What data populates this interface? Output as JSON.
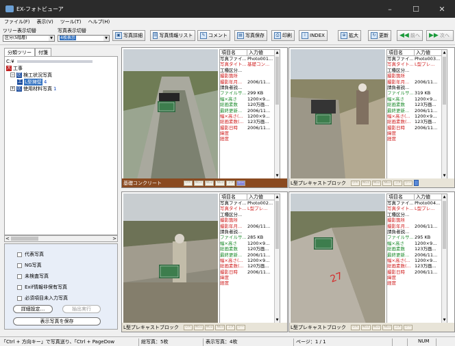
{
  "window": {
    "title": "EX-フォトビューア",
    "min": "–",
    "max": "☐",
    "close": "✕"
  },
  "menu": [
    "ファイル(F)",
    "表示(V)",
    "ツール(T)",
    "ヘルプ(H)"
  ],
  "toolbar": {
    "tree_switch_label": "ツリー表示切替",
    "photo_switch_label": "写真表示切替",
    "tree_mode": "区分(5階層)",
    "photo_mode": "4枚表示",
    "buttons": [
      "写真詳細",
      "写真情報リスト",
      "コメント",
      "写真保存",
      "印刷",
      "INDEX",
      "拡大",
      "更新",
      "前へ",
      "次へ"
    ]
  },
  "left": {
    "tabs": [
      "分類ツリー",
      "付箋"
    ],
    "path": "C:¥",
    "tree": {
      "root": "工事",
      "node1": "検工状況写真",
      "node2": "L型擁壁",
      "node2_count": "4",
      "node3": "使用材料写真",
      "node3_count": "1"
    },
    "filters": [
      "代表写真",
      "NG写真",
      "未検査写真",
      "Exif情報非保有写真",
      "必須項目未入力写真"
    ],
    "detail_button": "詳細設定...",
    "extract_button": "抽出実行",
    "save_button": "表示写真を保存"
  },
  "props_header": [
    "項目名",
    "入力値"
  ],
  "prop_names": [
    "写真ファイ...",
    "写真タイト...",
    "工種区分...",
    "撮影箇所",
    "撮影年月...",
    "請負者説...",
    "ファイルサ...",
    "幅×高さ",
    "総画素数",
    "最終更新...",
    "幅×高さ(...",
    "総画素数(...",
    "撮影日時",
    "緯度",
    "経度"
  ],
  "badges": [
    "ＯＫ",
    "NG1",
    "NG2",
    "NG3",
    "コメ",
    "シー"
  ],
  "photos": [
    {
      "file": "Photo001...",
      "title": "基礎コン...",
      "date": "2006/11...",
      "size": "299 KB",
      "wh": "1200×9...",
      "px": "120万画...",
      "mod": "2006/11...",
      "wh2": "1200×9...",
      "px2": "123万画...",
      "shot": "2006/11...",
      "caption": "基礎コンクリート"
    },
    {
      "file": "Photo003...",
      "title": "L型プレ...",
      "date": "2006/11...",
      "size": "319 KB",
      "wh": "1200×9...",
      "px": "123万画...",
      "mod": "2006/11...",
      "wh2": "1200×9...",
      "px2": "123万画...",
      "shot": "2006/11...",
      "caption": "L型プレキャストブロック"
    },
    {
      "file": "Photo002...",
      "title": "L型プレ...",
      "date": "2006/11...",
      "size": "285 KB",
      "wh": "1200×9...",
      "px": "120万画...",
      "mod": "2006/11...",
      "wh2": "1200×9...",
      "px2": "120万画...",
      "shot": "2006/11...",
      "caption": "L型プレキャストブロック"
    },
    {
      "file": "Photo004...",
      "title": "L型プレ...",
      "date": "2006/11...",
      "size": "295 KB",
      "wh": "1200×9...",
      "px": "123万画...",
      "mod": "2006/11...",
      "wh2": "1200×9...",
      "px2": "123万画...",
      "shot": "2006/11...",
      "caption": "L型プレキャストブロック"
    }
  ],
  "status": {
    "hint": "「Ctrl + 方向キー」で写真送り、「Ctrl + PageDow",
    "total": "総写真：5枚",
    "shown": "表示写真：4枚",
    "page": "ページ：1 / 1",
    "num": "NUM"
  }
}
